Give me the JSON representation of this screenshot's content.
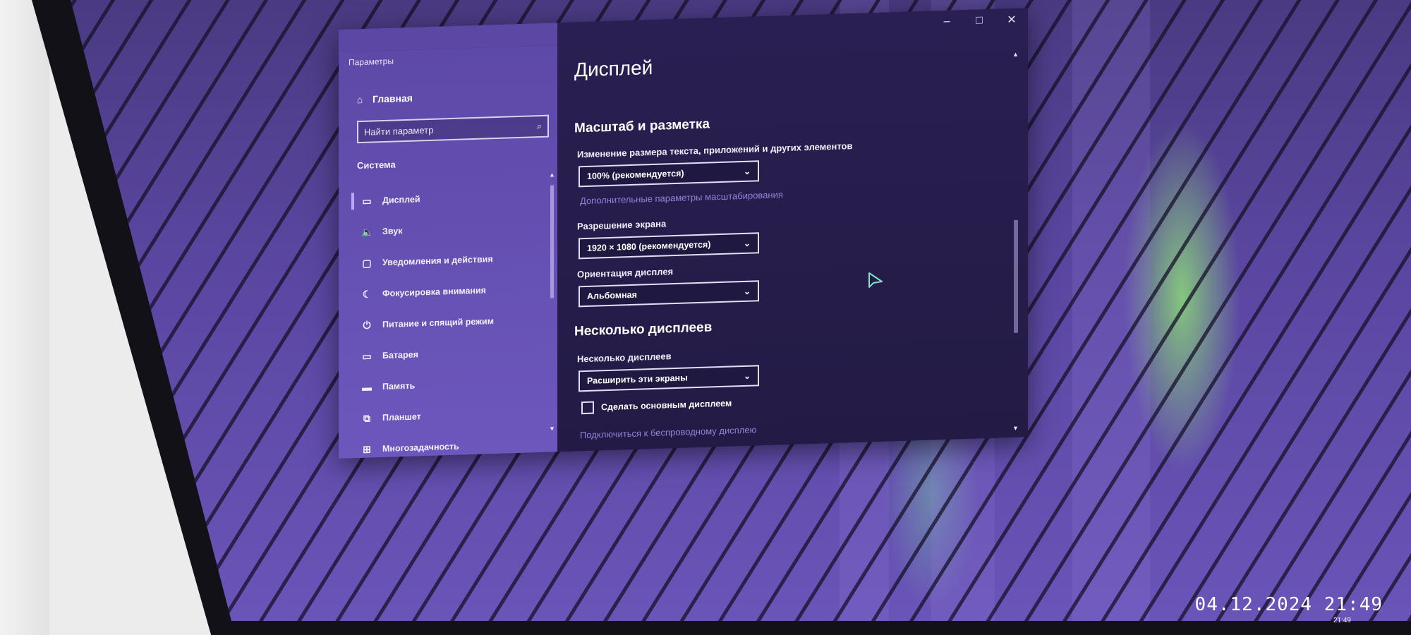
{
  "window": {
    "title": "Параметры",
    "controls": {
      "minimize": "–",
      "maximize": "□",
      "close": "✕"
    }
  },
  "sidebar": {
    "home_label": "Главная",
    "search_placeholder": "Найти параметр",
    "section": "Система",
    "items": [
      {
        "label": "Дисплей",
        "icon": "monitor-icon",
        "glyph": "▭",
        "active": true
      },
      {
        "label": "Звук",
        "icon": "speaker-icon",
        "glyph": "🔈"
      },
      {
        "label": "Уведомления и действия",
        "icon": "notification-icon",
        "glyph": "▢"
      },
      {
        "label": "Фокусировка внимания",
        "icon": "moon-icon",
        "glyph": "☾"
      },
      {
        "label": "Питание и спящий режим",
        "icon": "power-icon",
        "glyph": "⏻"
      },
      {
        "label": "Батарея",
        "icon": "battery-icon",
        "glyph": "▭"
      },
      {
        "label": "Память",
        "icon": "storage-icon",
        "glyph": "▬"
      },
      {
        "label": "Планшет",
        "icon": "tablet-icon",
        "glyph": "⧉"
      },
      {
        "label": "Многозадачность",
        "icon": "multitasking-icon",
        "glyph": "⊞"
      }
    ]
  },
  "content": {
    "page_title": "Дисплей",
    "scale_section": "Масштаб и разметка",
    "scale_label": "Изменение размера текста, приложений и других элементов",
    "scale_value": "100% (рекомендуется)",
    "advanced_scaling_link": "Дополнительные параметры масштабирования",
    "resolution_label": "Разрешение экрана",
    "resolution_value": "1920 × 1080 (рекомендуется)",
    "orientation_label": "Ориентация дисплея",
    "orientation_value": "Альбомная",
    "multi_section": "Несколько дисплеев",
    "multi_label": "Несколько дисплеев",
    "multi_value": "Расширить эти экраны",
    "main_display_checkbox": "Сделать основным дисплеем",
    "main_display_checked": false,
    "wireless_link": "Подключиться к беспроводному дисплею"
  },
  "photo_timestamp": "04.12.2024  21:49",
  "tray_time": "21:49"
}
